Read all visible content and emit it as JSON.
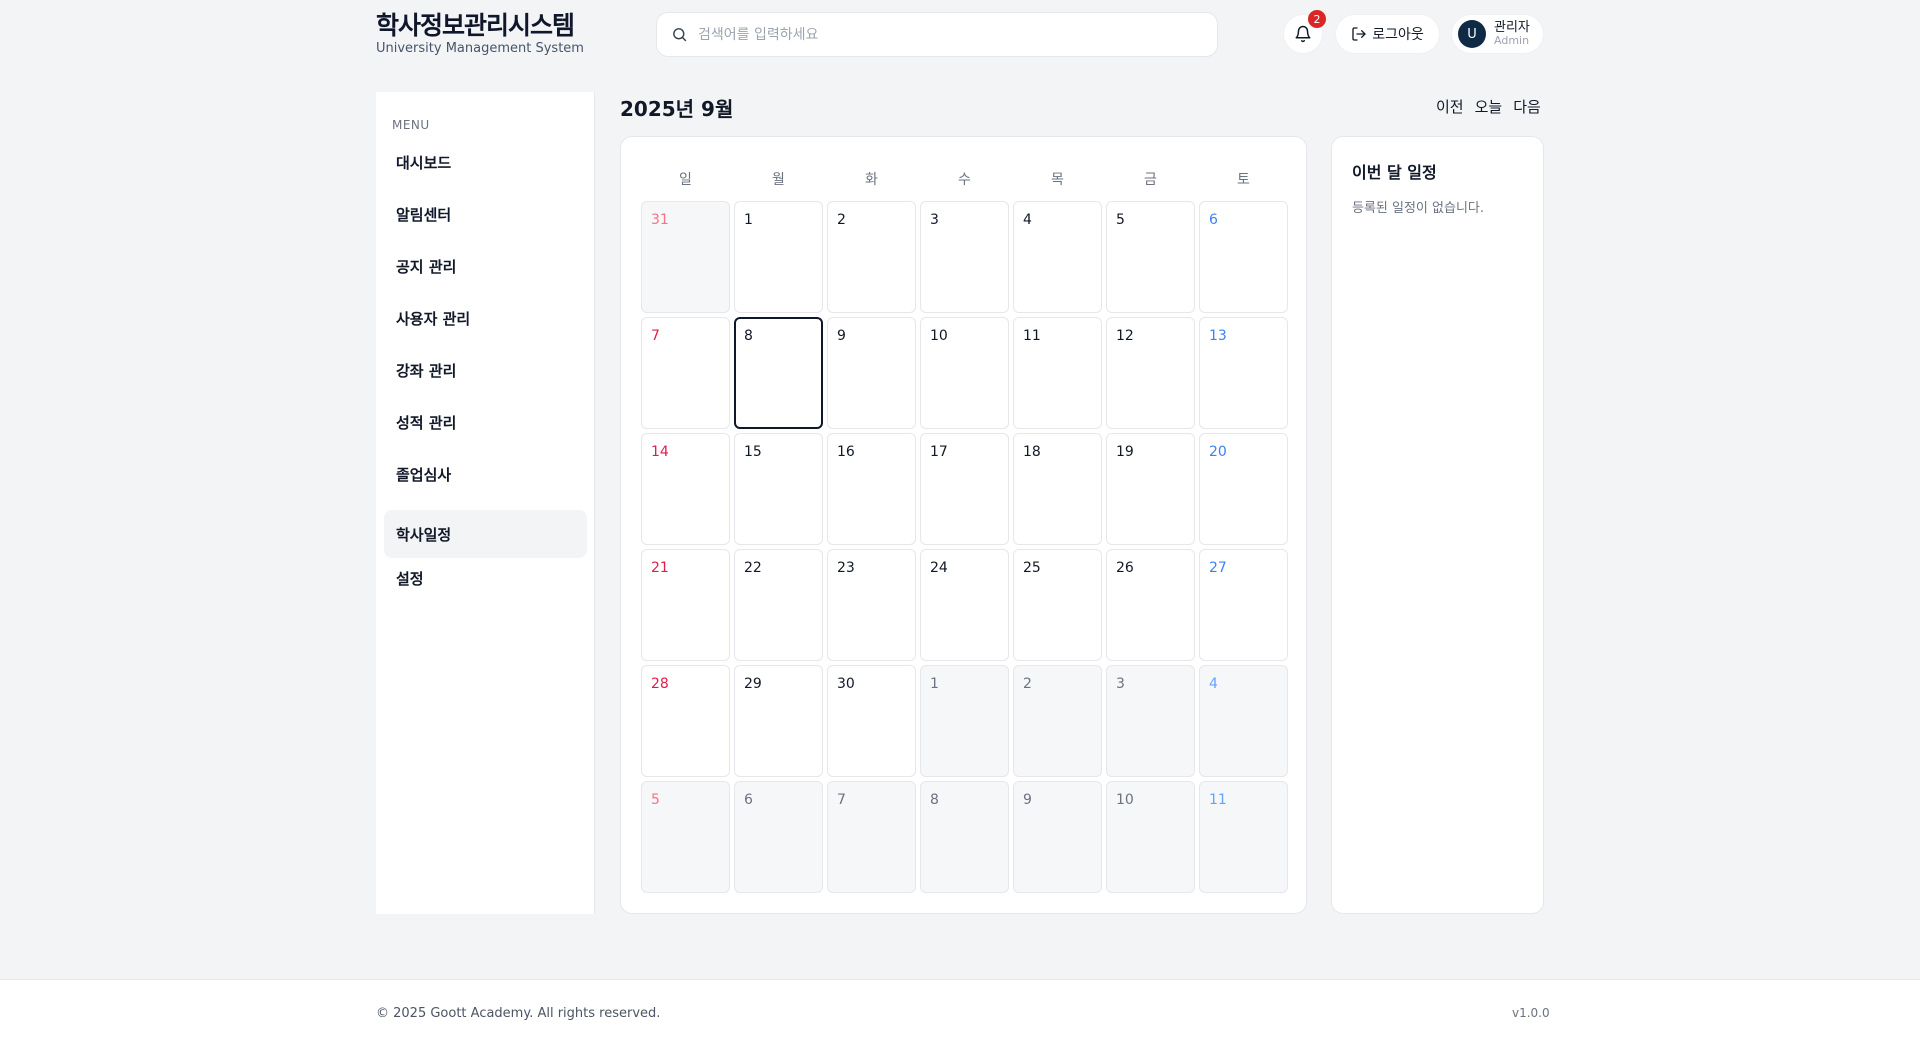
{
  "header": {
    "title": "학사정보관리시스템",
    "subtitle": "University Management System",
    "search_placeholder": "검색어를 입력하세요",
    "notification_count": "2",
    "logout_label": "로그아웃",
    "avatar_initial": "U",
    "user_name": "관리자",
    "user_role": "Admin"
  },
  "sidebar": {
    "menu_label": "MENU",
    "items": [
      {
        "label": "대시보드"
      },
      {
        "label": "알림센터"
      },
      {
        "label": "공지 관리"
      },
      {
        "label": "사용자 관리"
      },
      {
        "label": "강좌 관리"
      },
      {
        "label": "성적 관리"
      },
      {
        "label": "졸업심사"
      },
      {
        "label": "학사일정",
        "active": true
      },
      {
        "label": "설정"
      }
    ]
  },
  "calendar": {
    "title": "2025년 9월",
    "nav": {
      "prev": "이전",
      "today": "오늘",
      "next": "다음"
    },
    "weekdays": [
      "일",
      "월",
      "화",
      "수",
      "목",
      "금",
      "토"
    ],
    "days": [
      {
        "d": "31",
        "other": true
      },
      {
        "d": "1"
      },
      {
        "d": "2"
      },
      {
        "d": "3"
      },
      {
        "d": "4"
      },
      {
        "d": "5"
      },
      {
        "d": "6"
      },
      {
        "d": "7"
      },
      {
        "d": "8",
        "today": true
      },
      {
        "d": "9"
      },
      {
        "d": "10"
      },
      {
        "d": "11"
      },
      {
        "d": "12"
      },
      {
        "d": "13"
      },
      {
        "d": "14"
      },
      {
        "d": "15"
      },
      {
        "d": "16"
      },
      {
        "d": "17"
      },
      {
        "d": "18"
      },
      {
        "d": "19"
      },
      {
        "d": "20"
      },
      {
        "d": "21"
      },
      {
        "d": "22"
      },
      {
        "d": "23"
      },
      {
        "d": "24"
      },
      {
        "d": "25"
      },
      {
        "d": "26"
      },
      {
        "d": "27"
      },
      {
        "d": "28"
      },
      {
        "d": "29"
      },
      {
        "d": "30"
      },
      {
        "d": "1",
        "other": true
      },
      {
        "d": "2",
        "other": true
      },
      {
        "d": "3",
        "other": true
      },
      {
        "d": "4",
        "other": true
      },
      {
        "d": "5",
        "other": true
      },
      {
        "d": "6",
        "other": true
      },
      {
        "d": "7",
        "other": true
      },
      {
        "d": "8",
        "other": true
      },
      {
        "d": "9",
        "other": true
      },
      {
        "d": "10",
        "other": true
      },
      {
        "d": "11",
        "other": true
      }
    ]
  },
  "events": {
    "title": "이번 달 일정",
    "empty_text": "등록된 일정이 없습니다."
  },
  "footer": {
    "copyright": "© 2025 Goott Academy. All rights reserved.",
    "version": "v1.0.0"
  },
  "colors": {
    "brand": "#0f172a",
    "sunday": "#e11d48",
    "saturday": "#3b82f6",
    "badge": "#dc2626"
  }
}
